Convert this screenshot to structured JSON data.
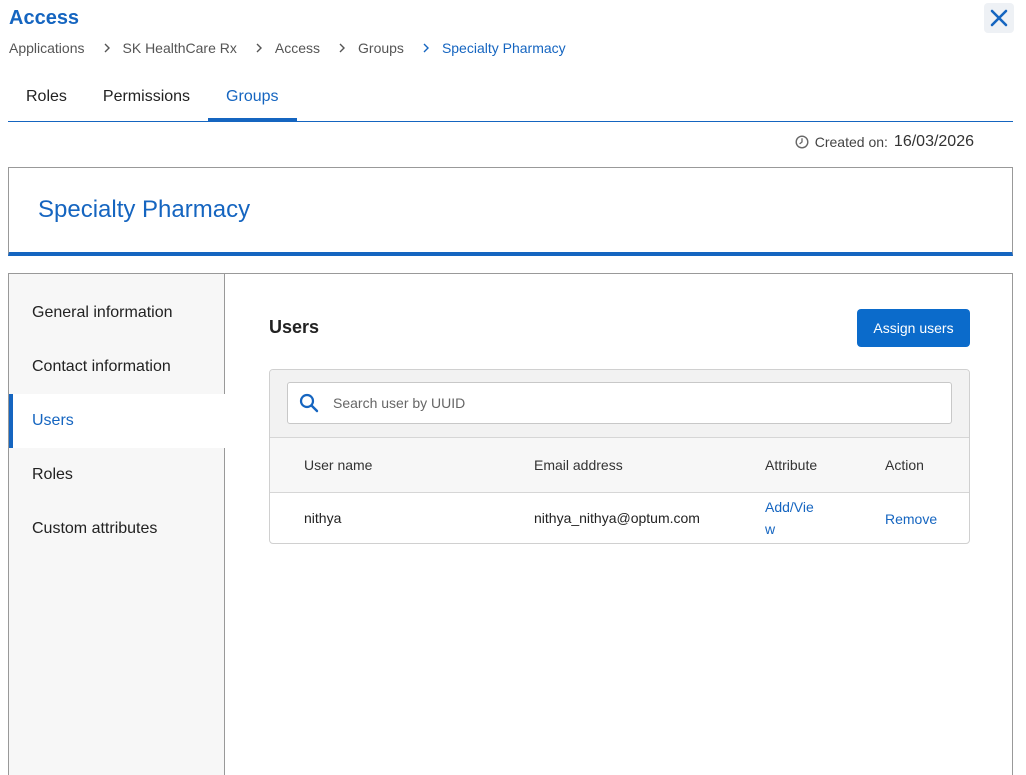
{
  "app": {
    "title": "Access"
  },
  "breadcrumb": [
    "Applications",
    "SK HealthCare Rx",
    "Access",
    "Groups",
    "Specialty Pharmacy"
  ],
  "tabs": [
    "Roles",
    "Permissions",
    "Groups"
  ],
  "active_tab": "Groups",
  "created": {
    "label": "Created on:",
    "date": "16/03/2026"
  },
  "group": {
    "name": "Specialty Pharmacy"
  },
  "sidenav": [
    "General information",
    "Contact information",
    "Users",
    "Roles",
    "Custom attributes"
  ],
  "active_nav": "Users",
  "users": {
    "title": "Users",
    "assign_label": "Assign users",
    "search_placeholder": "Search user by UUID",
    "columns": [
      "User name",
      "Email address",
      "Attribute",
      "Action"
    ],
    "rows": [
      {
        "name": "nithya",
        "email": "nithya_nithya@optum.com",
        "attribute": "Add/View",
        "action": "Remove"
      }
    ]
  },
  "colors": {
    "accent": "#1565c0",
    "button": "#0b6bcb"
  },
  "icons": {
    "close": "close-icon",
    "separator": "chevron-right-icon",
    "clock": "clock-icon",
    "search": "search-icon"
  }
}
